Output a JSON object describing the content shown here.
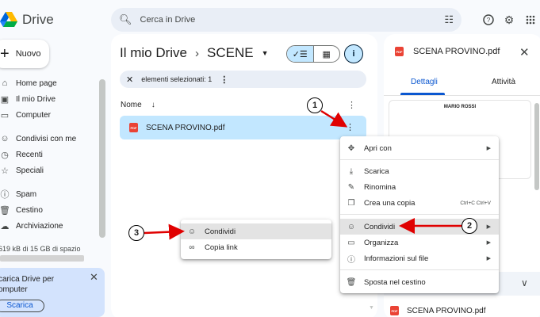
{
  "app": {
    "name": "Drive",
    "colors": {
      "accent": "#0b57d0",
      "selected": "#c2e7ff",
      "pdf": "#ea4335",
      "arrow": "#e00000"
    }
  },
  "search": {
    "placeholder": "Cerca in Drive"
  },
  "sidebar": {
    "new_label": "Nuovo",
    "items": [
      {
        "label": "Home page",
        "icon": "home-icon"
      },
      {
        "label": "Il mio Drive",
        "icon": "drive-icon"
      },
      {
        "label": "Computer",
        "icon": "computer-icon"
      },
      {
        "label": "Condivisi con me",
        "icon": "people-icon"
      },
      {
        "label": "Recenti",
        "icon": "clock-icon"
      },
      {
        "label": "Speciali",
        "icon": "star-icon"
      },
      {
        "label": "Spam",
        "icon": "spam-icon"
      },
      {
        "label": "Cestino",
        "icon": "trash-icon"
      },
      {
        "label": "Archiviazione",
        "icon": "cloud-icon"
      }
    ],
    "storage_text": "619 kB di 15 GB di spazio",
    "storage_used_fraction": 0.0001,
    "promo": {
      "text": "carica Drive per omputer",
      "button": "Scarica"
    }
  },
  "main": {
    "breadcrumb": {
      "root": "Il mio Drive",
      "current": "SCENE"
    },
    "selection_text": "elementi selezionati: 1",
    "column_name": "Nome",
    "file": {
      "name": "SCENA PROVINO.pdf",
      "type_badge": "PDF"
    }
  },
  "details_panel": {
    "title": "SCENA PROVINO.pdf",
    "tabs": [
      "Dettagli",
      "Attività"
    ],
    "active_tab": "Dettagli",
    "preview_text": "MARIO ROSSI",
    "footer_file": "SCENA PROVINO.pdf"
  },
  "context_menu": {
    "items": [
      {
        "label": "Apri con",
        "icon": "move-icon",
        "submenu": true
      },
      {
        "label": "Scarica",
        "icon": "download-icon"
      },
      {
        "label": "Rinomina",
        "icon": "pencil-icon"
      },
      {
        "label": "Crea una copia",
        "icon": "copy-icon",
        "shortcut": "Ctrl+C Ctrl+V"
      },
      {
        "label": "Condividi",
        "icon": "person-add-icon",
        "submenu": true,
        "highlighted": true
      },
      {
        "label": "Organizza",
        "icon": "folder-icon",
        "submenu": true
      },
      {
        "label": "Informazioni sul file",
        "icon": "info-icon",
        "submenu": true
      },
      {
        "label": "Sposta nel cestino",
        "icon": "trash-icon"
      }
    ]
  },
  "share_submenu": {
    "items": [
      {
        "label": "Condividi",
        "icon": "person-add-icon",
        "highlighted": true
      },
      {
        "label": "Copia link",
        "icon": "link-icon"
      }
    ]
  },
  "callouts": [
    "1",
    "2",
    "3"
  ]
}
